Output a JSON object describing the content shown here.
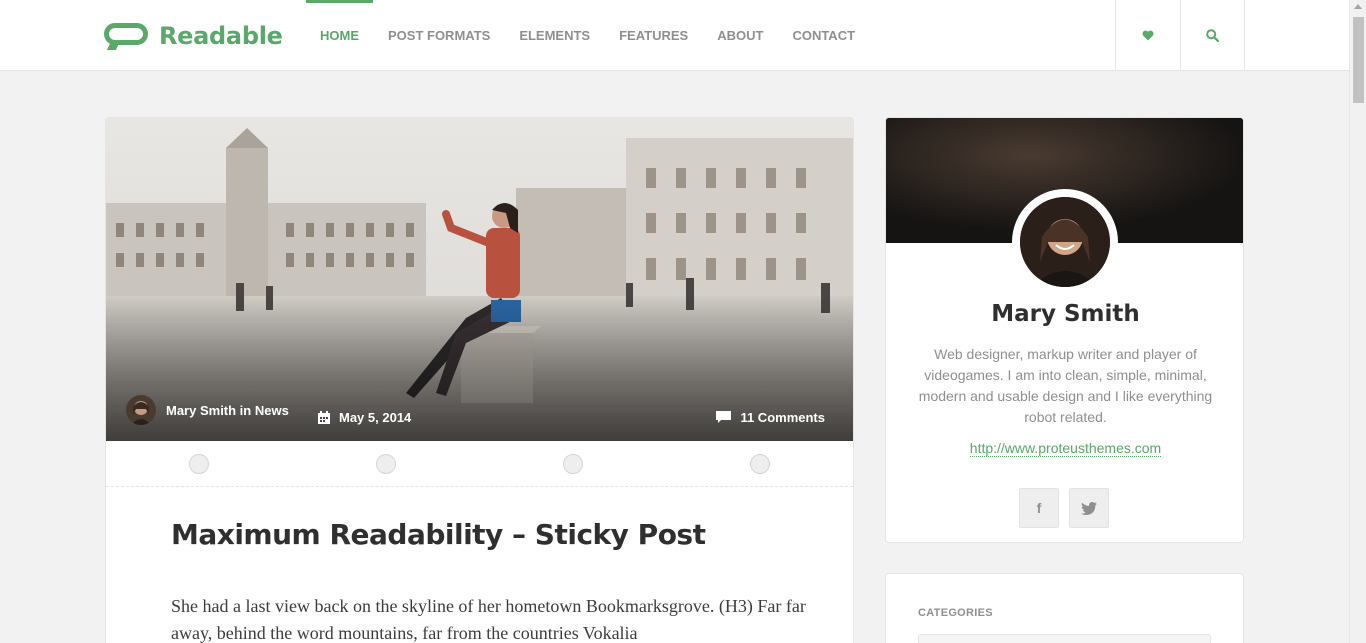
{
  "brand": {
    "name": "Readable",
    "color": "#5aa86a"
  },
  "nav": {
    "items": [
      {
        "label": "HOME",
        "active": true
      },
      {
        "label": "POST FORMATS",
        "active": false
      },
      {
        "label": "ELEMENTS",
        "active": false
      },
      {
        "label": "FEATURES",
        "active": false
      },
      {
        "label": "ABOUT",
        "active": false
      },
      {
        "label": "CONTACT",
        "active": false
      }
    ],
    "icons": [
      "heart-icon",
      "search-icon"
    ]
  },
  "post": {
    "author_line": "Mary Smith in News",
    "date": "May 5, 2014",
    "comments": "11 Comments",
    "title": "Maximum Readability – Sticky Post",
    "excerpt": "She had a last view back on the skyline of her hometown Bookmarksgrove. (H3) Far far away, behind the word mountains, far from the countries Vokalia"
  },
  "sidebar": {
    "about": {
      "name": "Mary Smith",
      "bio": "Web designer, markup writer and player of videogames. I am into clean, simple, minimal, modern and usable design and I like everything robot related.",
      "link": "http://www.proteusthemes.com",
      "socials": [
        "facebook-icon",
        "twitter-icon"
      ]
    },
    "categories": {
      "title": "CATEGORIES"
    }
  }
}
